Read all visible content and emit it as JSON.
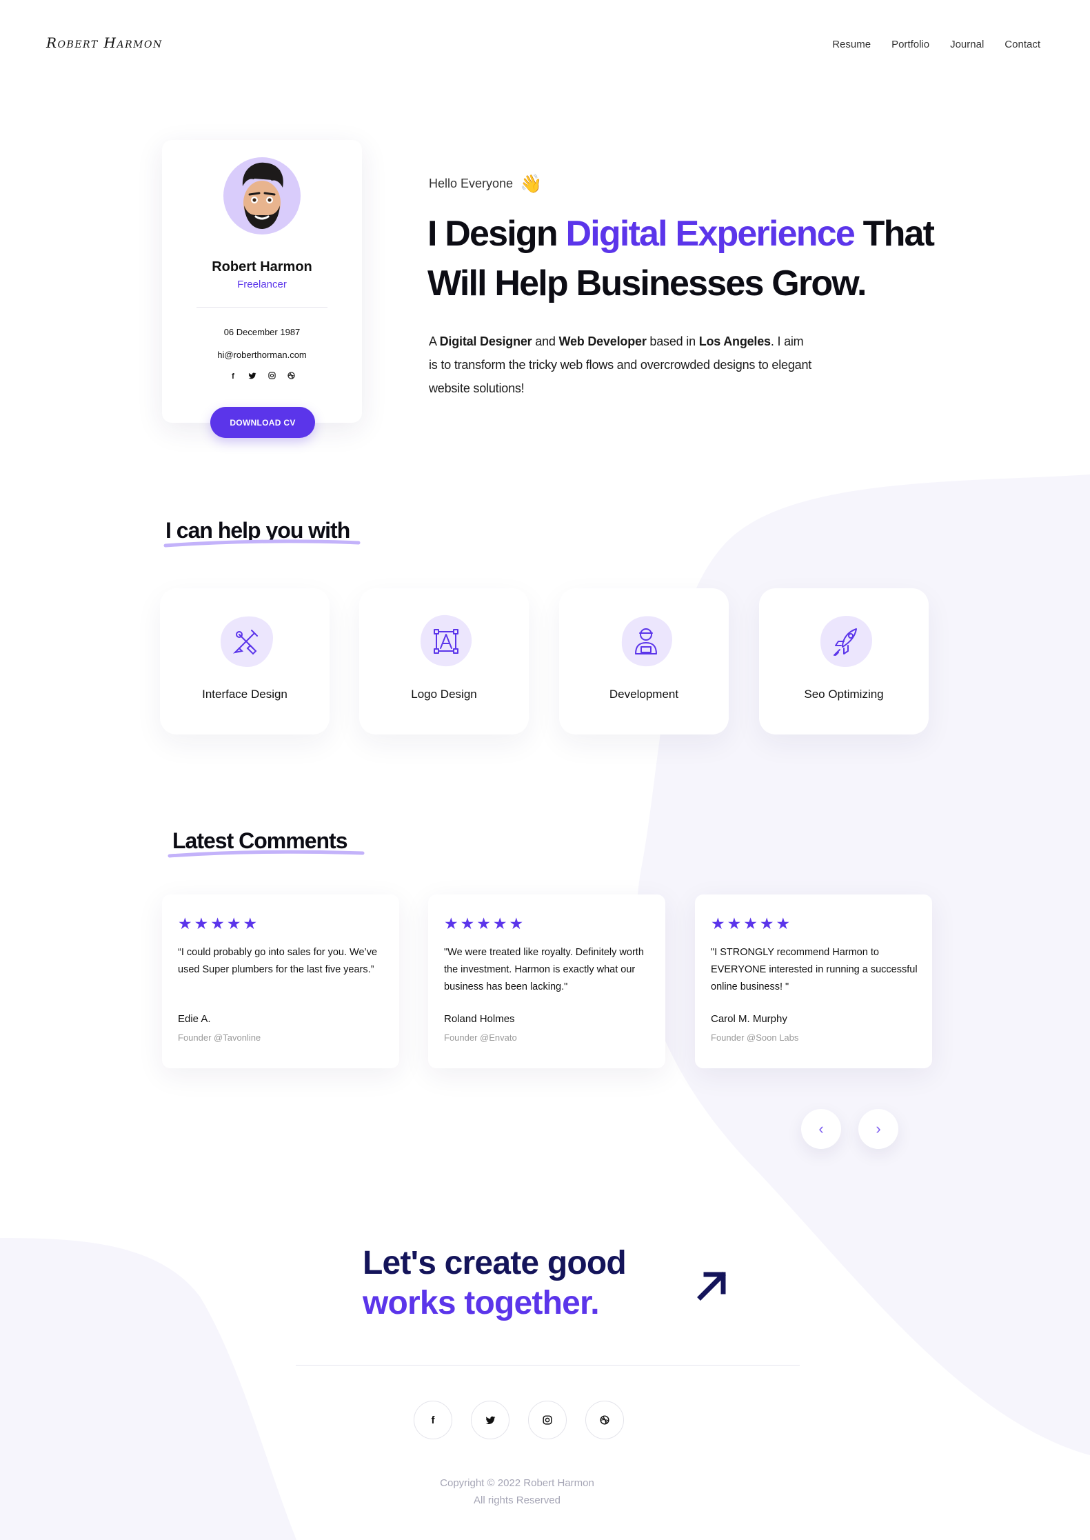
{
  "header": {
    "logo": "Robert Harmon",
    "nav": [
      "Resume",
      "Portfolio",
      "Journal",
      "Contact"
    ]
  },
  "profile": {
    "name": "Robert Harmon",
    "role": "Freelancer",
    "dob": "06 December 1987",
    "email": "hi@roberthorman.com",
    "social_icons": [
      "facebook-icon",
      "twitter-icon",
      "instagram-icon",
      "dribbble-icon"
    ],
    "cta": "DOWNLOAD CV"
  },
  "hero": {
    "greeting": "Hello Everyone",
    "greeting_emoji": "👋",
    "headline_pre": "I Design ",
    "headline_accent": "Digital Experience",
    "headline_post": " That Will Help Businesses Grow.",
    "bio_1": "A ",
    "bio_b1": "Digital Designer",
    "bio_2": " and  ",
    "bio_b2": "Web Developer",
    "bio_3": " based in ",
    "bio_b3": "Los Angeles",
    "bio_4": ". I aim is to transform the tricky web flows and overcrowded designs to elegant website solutions!"
  },
  "services": {
    "title": "I can help you with",
    "items": [
      {
        "label": "Interface Design",
        "icon": "design-tools-icon"
      },
      {
        "label": "Logo Design",
        "icon": "logo-letter-icon"
      },
      {
        "label": "Development",
        "icon": "developer-icon"
      },
      {
        "label": "Seo Optimizing",
        "icon": "rocket-icon"
      }
    ]
  },
  "comments": {
    "title": "Latest Comments",
    "items": [
      {
        "stars": "★★★★★",
        "rating": 5,
        "quote": "“I could probably go into sales for you. We’ve used Super plumbers for the last five years.”",
        "author": "Edie A.",
        "company": "Founder @Tavonline"
      },
      {
        "stars": "★★★★★",
        "rating": 5,
        "quote": "\"We were treated like royalty. Definitely worth the investment. Harmon is exactly what our business has been lacking.\"",
        "author": "Roland Holmes",
        "company": "Founder @Envato"
      },
      {
        "stars": "★★★★★",
        "rating": 5,
        "quote": "\"I STRONGLY recommend Harmon to EVERYONE interested in running a successful online business! \"",
        "author": "Carol M. Murphy",
        "company": "Founder @Soon Labs"
      }
    ],
    "prev": "‹",
    "next": "›"
  },
  "cta": {
    "line1": "Let's create good",
    "line2": "works together."
  },
  "footer": {
    "social_icons": [
      "facebook-icon",
      "twitter-icon",
      "instagram-icon",
      "dribbble-icon"
    ],
    "copyright": "Copyright © 2022 Robert Harmon",
    "rights": "All rights Reserved"
  },
  "colors": {
    "accent": "#5b35ea",
    "dark_navy": "#14145a",
    "background_blob": "#f6f5fc",
    "avatar_bg": "#d9ccfb"
  }
}
